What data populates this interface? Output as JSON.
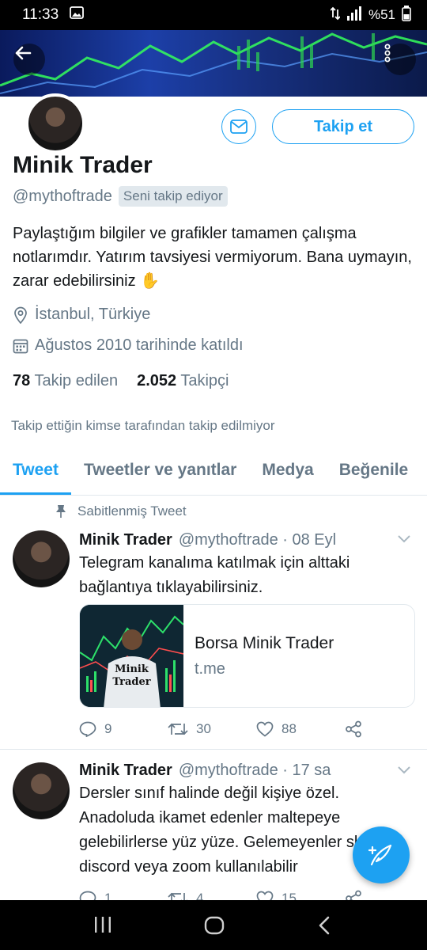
{
  "status_bar": {
    "time": "11:33",
    "battery": "%51"
  },
  "profile": {
    "name": "Minik Trader",
    "handle": "@mythoftrade",
    "follows_you": "Seni takip ediyor",
    "bio": "Paylaştığım bilgiler ve grafikler tamamen çalışma notlarımdır. Yatırım tavsiyesi vermiyorum. Bana uymayın, zarar edebilirsiniz ✋",
    "location": "İstanbul, Türkiye",
    "joined": "Ağustos 2010 tarihinde katıldı",
    "following_count": "78",
    "following_label": "Takip edilen",
    "followers_count": "2.052",
    "followers_label": "Takipçi",
    "no_known_followers": "Takip ettiğin kimse tarafından takip edilmiyor",
    "follow_button": "Takip et"
  },
  "tabs": [
    "Tweet",
    "Tweetler ve yanıtlar",
    "Medya",
    "Beğenile"
  ],
  "pinned_label": "Sabitlenmiş Tweet",
  "tweets": [
    {
      "name": "Minik Trader",
      "handle": "@mythoftrade · 08 Eyl",
      "text": "Telegram kanalıma katılmak için alttaki bağlantıya tıklayabilirsiniz.",
      "card": {
        "title": "Borsa Minik Trader",
        "domain": "t.me",
        "image_caption_1": "Minik",
        "image_caption_2": "Trader"
      },
      "replies": "9",
      "retweets": "30",
      "likes": "88"
    },
    {
      "name": "Minik Trader",
      "handle": "@mythoftrade · 17 sa",
      "text": "Dersler sınıf halinde değil kişiye özel. Anadoluda ikamet edenler maltepeye gelebilirlerse yüz yüze. Gelemeyenler skype discord veya zoom kullanılabilir",
      "replies": "1",
      "retweets": "4",
      "likes": "15"
    }
  ],
  "colors": {
    "accent": "#1da1f2",
    "secondary_text": "#657786",
    "divider": "#e1e8ed"
  }
}
